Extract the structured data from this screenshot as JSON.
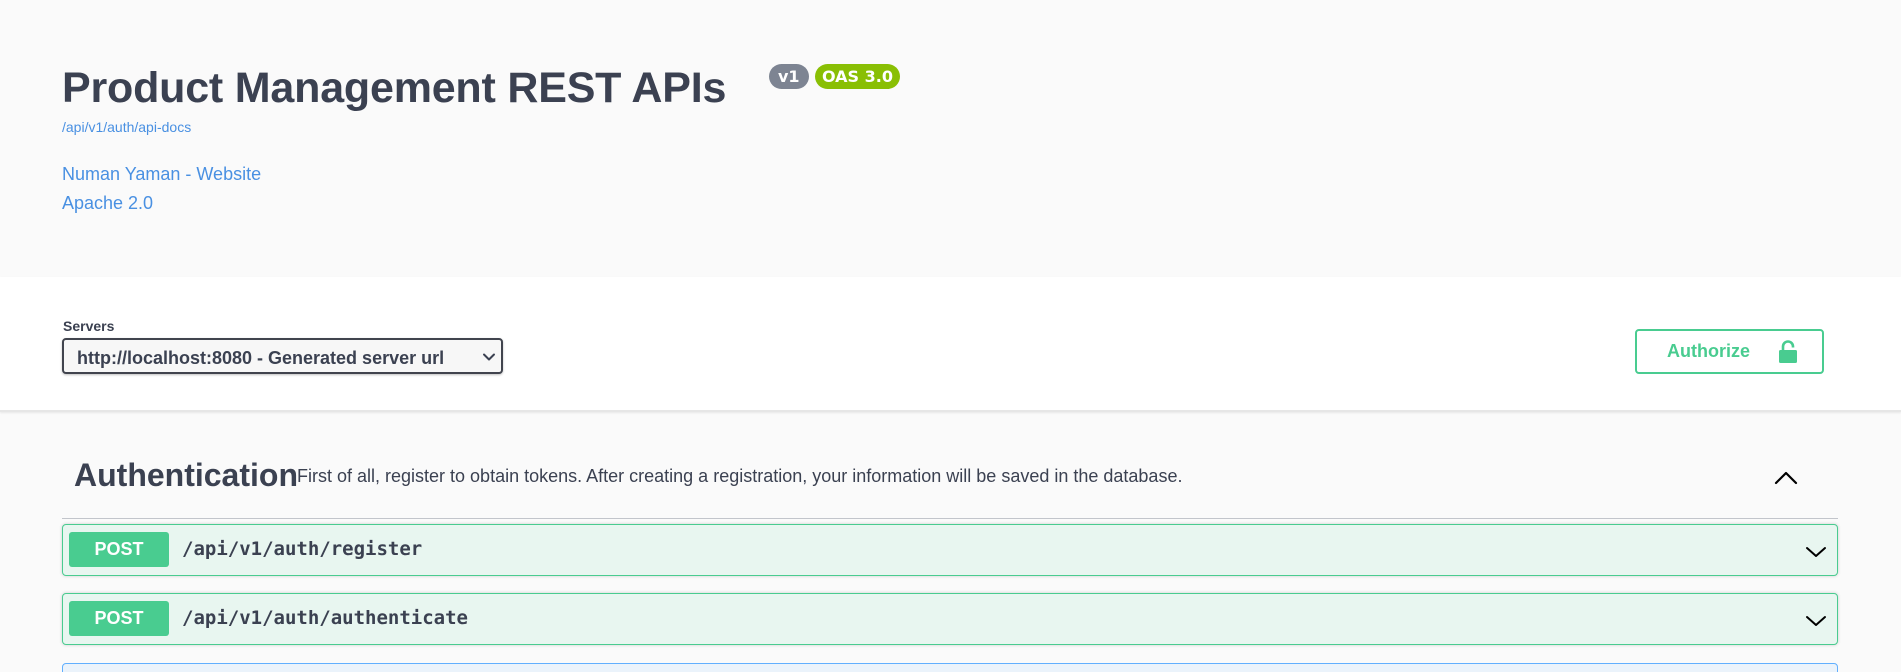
{
  "info": {
    "title": "Product Management REST APIs",
    "version_badge": "v1",
    "oas_badge": "OAS 3.0",
    "doc_url": "/api/v1/auth/api-docs",
    "contact_link": "Numan Yaman - Website",
    "license_link": "Apache 2.0"
  },
  "servers": {
    "label": "Servers",
    "selected": "http://localhost:8080 - Generated server url"
  },
  "authorize": {
    "label": "Authorize"
  },
  "tag": {
    "title": "Authentication",
    "description": "First of all, register to obtain tokens. After creating a registration, your information will be saved in the database.",
    "expanded": true
  },
  "operations": [
    {
      "method": "POST",
      "path": "/api/v1/auth/register"
    },
    {
      "method": "POST",
      "path": "/api/v1/auth/authenticate"
    }
  ],
  "colors": {
    "post": "#49cc90",
    "link": "#4990e2",
    "text": "#3b4151",
    "oas_badge": "#89bf04",
    "version_badge": "#7d8492"
  }
}
